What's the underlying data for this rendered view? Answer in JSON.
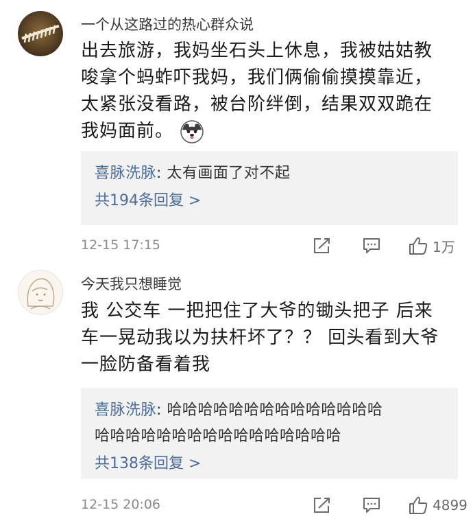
{
  "comments": [
    {
      "username": "一个从这路过的热心群众说",
      "text_lines": [
        "出去旅游，我妈坐石头上休息，我被姑姑教",
        "唆拿个蚂蚱吓我妈，我们俩偷偷摸摸靠近，",
        "太紧张没看路，被台阶绊倒，结果双双跪在",
        "我妈面前。"
      ],
      "emoji_icon": "husky-face-icon",
      "reply": {
        "lines": [
          {
            "user": "喜脉洗脉",
            "sep": ": ",
            "text": "太有画面了对不起"
          }
        ],
        "count_label": "共194条回复 >"
      },
      "timestamp": "12-15 17:15",
      "like_count": "1万"
    },
    {
      "username": "今天我只想睡觉",
      "text_lines": [
        "我  公交车  一把把住了大爷的锄头把子  后来",
        "车一晃动我以为扶杆坏了？？ 回头看到大爷",
        "一脸防备看着我"
      ],
      "reply": {
        "lines": [
          {
            "user": "喜脉洗脉",
            "sep": ": ",
            "text": "哈哈哈哈哈哈哈哈哈哈哈哈哈哈"
          },
          {
            "user": "",
            "sep": "",
            "text": "哈哈哈哈哈哈哈哈哈哈哈哈哈哈哈哈"
          }
        ],
        "count_label": "共138条回复 >"
      },
      "timestamp": "12-15 20:06",
      "like_count": "4899"
    }
  ],
  "icons": {
    "forward": "forward-icon",
    "comment": "comment-icon",
    "like": "thumbs-up-icon"
  },
  "colors": {
    "reply_user": "#4a6d9c",
    "reply_bg": "#f2f2f2",
    "meta_gray": "#8a8a8a"
  }
}
